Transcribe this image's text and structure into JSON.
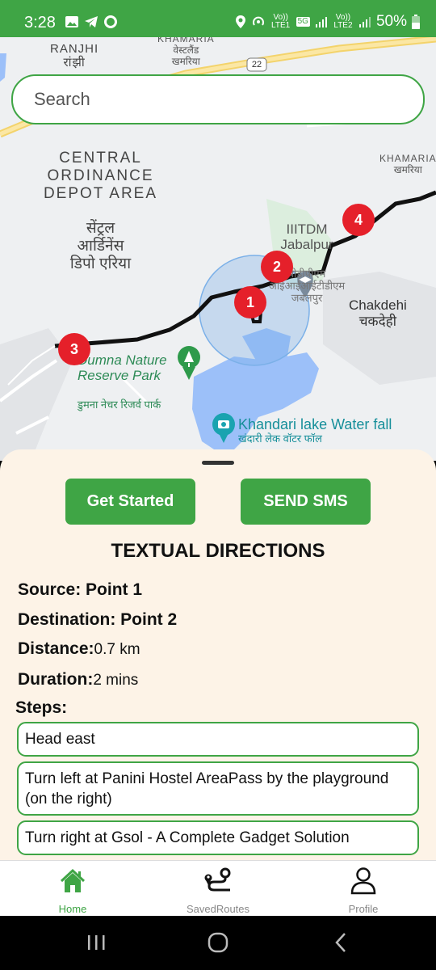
{
  "status_bar": {
    "time": "3:28",
    "network_1": "Vo)) LTE1",
    "network_5g": "5G",
    "network_2": "Vo)) LTE2",
    "battery": "50%"
  },
  "map": {
    "labels": {
      "ranjhi_en": "RANJHI",
      "ranjhi_hi": "रांझी",
      "khamaria_top_en": "KHAMARIA",
      "khamaria_top_hi1": "वेस्टलैंड",
      "khamaria_top_hi2": "खमरिया",
      "highway": "22",
      "depot_en": "CENTRAL\nORDINANCE\nDEPOT AREA",
      "depot_hi": "सेंट्रल\nआर्डिनेंस\nडिपो एरिया",
      "khamaria_right_en": "KHAMARIA",
      "khamaria_right_hi": "खमरिया",
      "iiitdm_en": "IIITDM\nJabalpur",
      "iiitdm_hi": "पीडीपीएम आईआईआईटीडीएम जबलपुर",
      "chakdehi_en": "Chakdehi",
      "chakdehi_hi": "चकदेही",
      "park_en": "Dumna Nature\nReserve Park",
      "park_hi": "डुमना नेचर रिजर्व पार्क",
      "lake_en": "Khandari lake Water fall",
      "lake_hi": "खंदारी लेक वॉटर फॉल"
    },
    "pins": [
      "1",
      "2",
      "3",
      "4"
    ]
  },
  "search": {
    "placeholder": "Search"
  },
  "sheet": {
    "get_started": "Get Started",
    "send_sms": "SEND SMS",
    "title": "TEXTUAL DIRECTIONS",
    "source_label": "Source: Point 1",
    "destination_label": "Destination: Point 2",
    "distance_label": "Distance:",
    "distance_value": "0.7 km",
    "duration_label": "Duration:",
    "duration_value": "2 mins",
    "steps_label": "Steps:",
    "steps": [
      "Head east",
      "Turn left at Panini Hostel AreaPass by the playground (on the right)",
      "Turn right at Gsol - A Complete Gadget Solution"
    ]
  },
  "bottom_nav": {
    "home": "Home",
    "saved_routes": "SavedRoutes",
    "profile": "Profile",
    "active_color": "#3fa545"
  }
}
